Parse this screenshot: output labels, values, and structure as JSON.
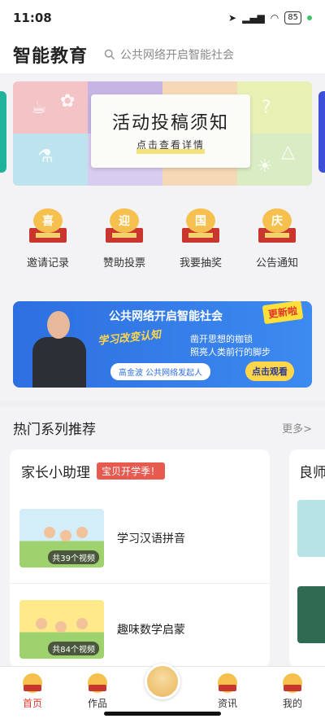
{
  "status_bar": {
    "time": "11:08",
    "battery": "85"
  },
  "header": {
    "brand": "智能教育",
    "search_placeholder": "公共网络开启智能社会"
  },
  "banner": {
    "title": "活动投稿须知",
    "subtitle": "点击查看详情"
  },
  "quick_nav": [
    {
      "badge": "喜",
      "label": "邀请记录"
    },
    {
      "badge": "迎",
      "label": "赞助投票"
    },
    {
      "badge": "国",
      "label": "我要抽奖"
    },
    {
      "badge": "庆",
      "label": "公告通知"
    }
  ],
  "promo": {
    "title": "公共网络开启智能社会",
    "tag": "更新啦",
    "slogan": "学习改变认知",
    "line1": "凿开思想的枷锁",
    "line2": "照亮人类前行的脚步",
    "speaker": "高金波 公共网络发起人",
    "watch": "点击观看"
  },
  "section": {
    "title": "热门系列推荐",
    "more": "更多>"
  },
  "card_main": {
    "title": "家长小助理",
    "badge": "宝贝开学季！",
    "items": [
      {
        "count": "共39个视频",
        "label": "学习汉语拼音"
      },
      {
        "count": "共84个视频",
        "label": "趣味数学启蒙"
      }
    ]
  },
  "card_peek": {
    "title": "良师"
  },
  "tabbar": [
    {
      "badge": "欢",
      "label": "首页",
      "active": true
    },
    {
      "badge": "度",
      "label": "作品"
    },
    {
      "badge": "中",
      "label": "资讯"
    },
    {
      "badge": "秋",
      "label": "我的"
    }
  ],
  "colors": {
    "accent": "#e23a30",
    "promo_blue": "#2d6fe0",
    "badge_red": "#e65a4f"
  }
}
